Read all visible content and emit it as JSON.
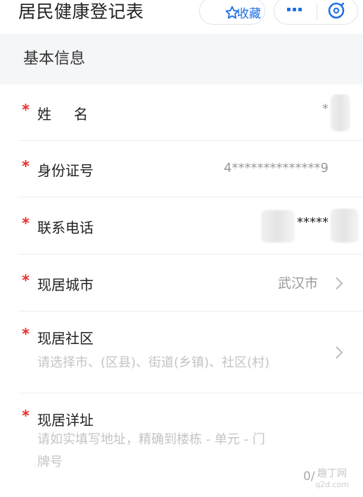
{
  "header": {
    "title": "居民健康登记表",
    "favorite_label": "收藏",
    "accent": "#1e6fe5"
  },
  "section": {
    "title": "基本信息"
  },
  "required_mark": "*",
  "fields": {
    "name": {
      "label": "姓名",
      "value": "*"
    },
    "id_number": {
      "label": "身份证号",
      "value": "4**************9"
    },
    "phone": {
      "label": "联系电话",
      "value": "*****"
    },
    "city": {
      "label": "现居城市",
      "value": "武汉市"
    },
    "community": {
      "label": "现居社区",
      "placeholder": "请选择市、(区县)、街道(乡镇)、社区(村)"
    },
    "address": {
      "label": "现居详址",
      "placeholder_line1": "请如实填写地址，精确到楼栋 - 单元 - 门",
      "placeholder_line2": "牌号",
      "counter": "0/"
    }
  },
  "watermark": {
    "text": "趣丁网",
    "sub": "q2d.com"
  },
  "colors": {
    "required": "#e52f2f",
    "section_bg": "#f5f6f8",
    "placeholder": "#c4c4c4",
    "value": "#999999"
  }
}
